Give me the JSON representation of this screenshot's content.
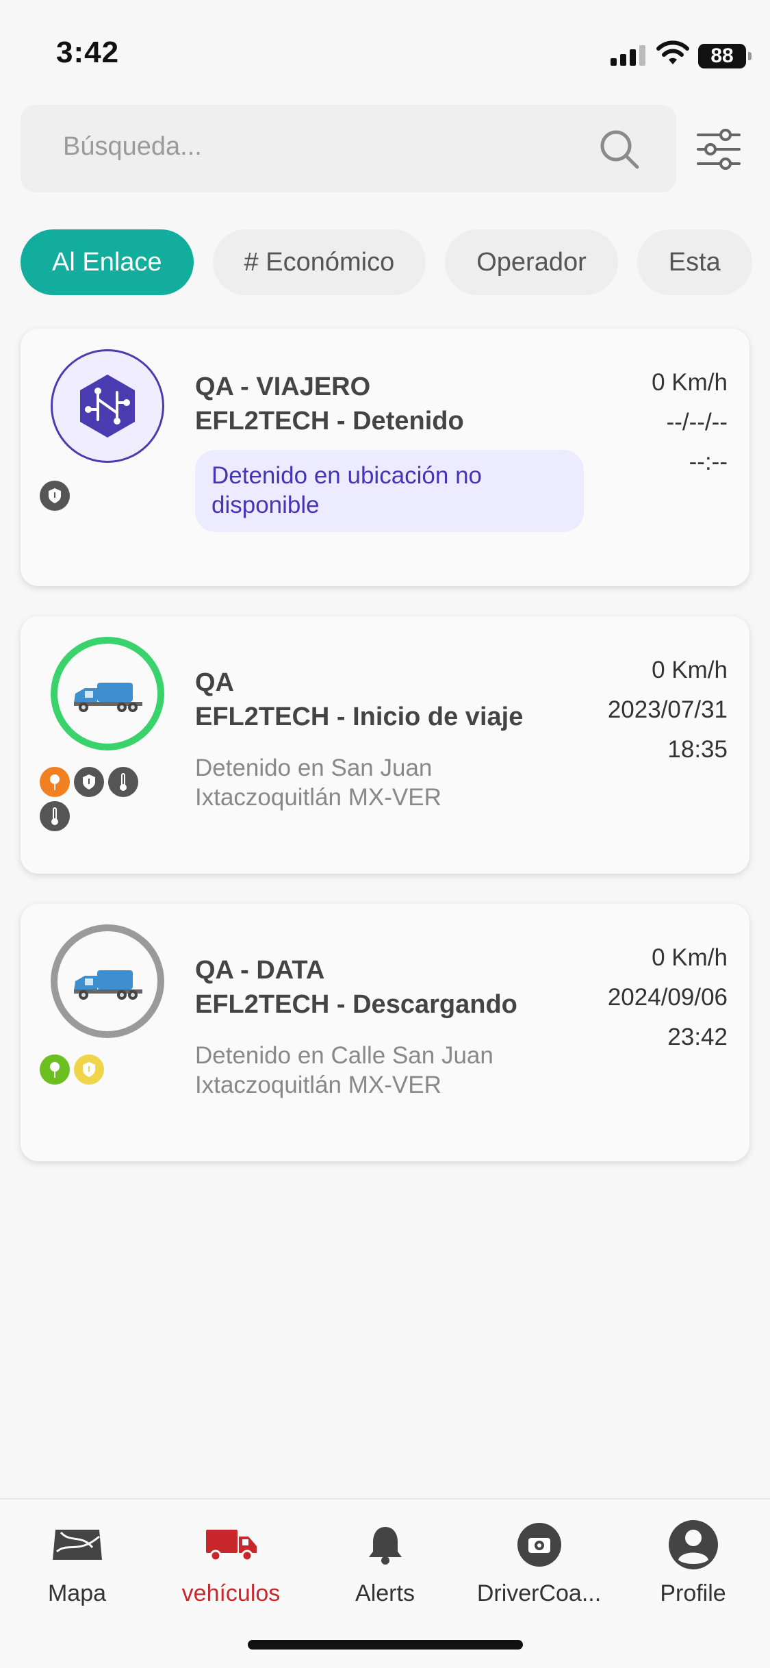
{
  "status_bar": {
    "time": "3:42",
    "battery": "88"
  },
  "search": {
    "placeholder": "Búsqueda..."
  },
  "chips": [
    "Al Enlace",
    "# Económico",
    "Operador",
    "Esta"
  ],
  "vehicles": [
    {
      "line1": "QA - VIAJERO",
      "line2": "EFL2TECH - Detenido",
      "location": "Detenido en ubicación no disponible",
      "speed": "0 Km/h",
      "date": "--/--/--",
      "time": "--:--"
    },
    {
      "line1": "QA",
      "line2": "EFL2TECH - Inicio de viaje",
      "location": "Detenido en San Juan Ixtaczoquitlán MX-VER",
      "speed": "0 Km/h",
      "date": "2023/07/31",
      "time": "18:35"
    },
    {
      "line1": "QA - DATA",
      "line2": "EFL2TECH - Descargando",
      "location": "Detenido en Calle San Juan Ixtaczoquitlán MX-VER",
      "speed": "0 Km/h",
      "date": "2024/09/06",
      "time": "23:42"
    }
  ],
  "nav": [
    {
      "label": "Mapa",
      "icon": "map-icon"
    },
    {
      "label": "vehículos",
      "icon": "truck-icon",
      "active": true
    },
    {
      "label": "Alerts",
      "icon": "bell-icon"
    },
    {
      "label": "DriverCoa...",
      "icon": "camera-icon"
    },
    {
      "label": "Profile",
      "icon": "profile-icon"
    }
  ],
  "colors": {
    "accent": "#12ad9c",
    "active_nav": "#c8282c",
    "status_purple": "#4535b6"
  }
}
